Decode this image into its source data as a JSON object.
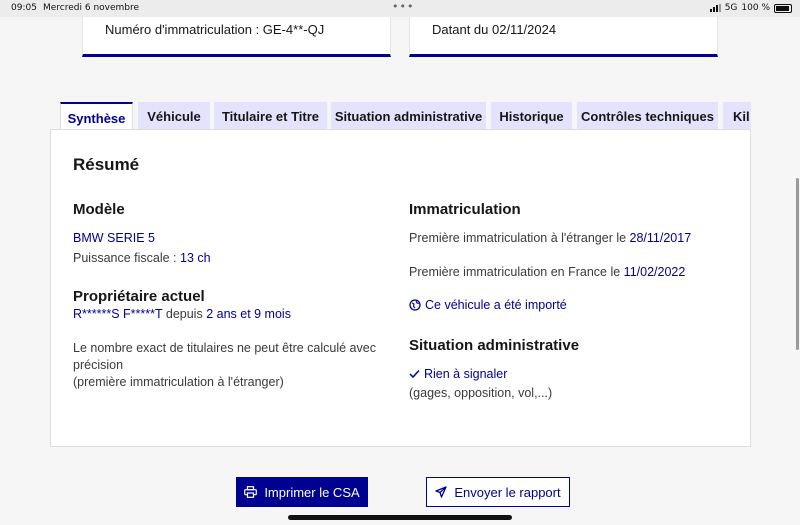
{
  "status_bar": {
    "time": "09:05",
    "date": "Mercredi 6 novembre",
    "network": "5G",
    "battery": "100 %"
  },
  "summary_cards": {
    "registration": "Numéro d'immatriculation : GE-4**-QJ",
    "dated": "Datant du 02/11/2024"
  },
  "tabs": [
    {
      "label": "Synthèse",
      "active": true
    },
    {
      "label": "Véhicule",
      "active": false
    },
    {
      "label": "Titulaire et Titre",
      "active": false
    },
    {
      "label": "Situation administrative",
      "active": false
    },
    {
      "label": "Historique",
      "active": false
    },
    {
      "label": "Contrôles techniques",
      "active": false
    },
    {
      "label": "Kil",
      "active": false
    }
  ],
  "resume": {
    "title": "Résumé",
    "modele": {
      "heading": "Modèle",
      "name": "BMW SERIE 5",
      "power_label": "Puissance fiscale : ",
      "power_value": "13 ch"
    },
    "proprietaire": {
      "heading": "Propriétaire actuel",
      "owner_name": "R******S F*****T",
      "since_label": " depuis ",
      "duration": "2 ans et 9 mois",
      "note_line1": "Le nombre exact de titulaires ne peut être calculé avec",
      "note_line2": "précision",
      "note_line3": "(première immatriculation à l'étranger)"
    },
    "immatriculation": {
      "heading": "Immatriculation",
      "foreign_label": "Première immatriculation à l'étranger le ",
      "foreign_date": "28/11/2017",
      "france_label": "Première immatriculation en France le ",
      "france_date": "11/02/2022",
      "imported_link": "Ce véhicule a été importé"
    },
    "situation": {
      "heading": "Situation administrative",
      "status": "Rien à signaler",
      "details": "(gages, opposition, vol,...)"
    }
  },
  "actions": {
    "print_label": "Imprimer le CSA",
    "send_label": "Envoyer le rapport"
  },
  "colors": {
    "primary": "#000091",
    "tab_bg": "#e3e3fd"
  }
}
